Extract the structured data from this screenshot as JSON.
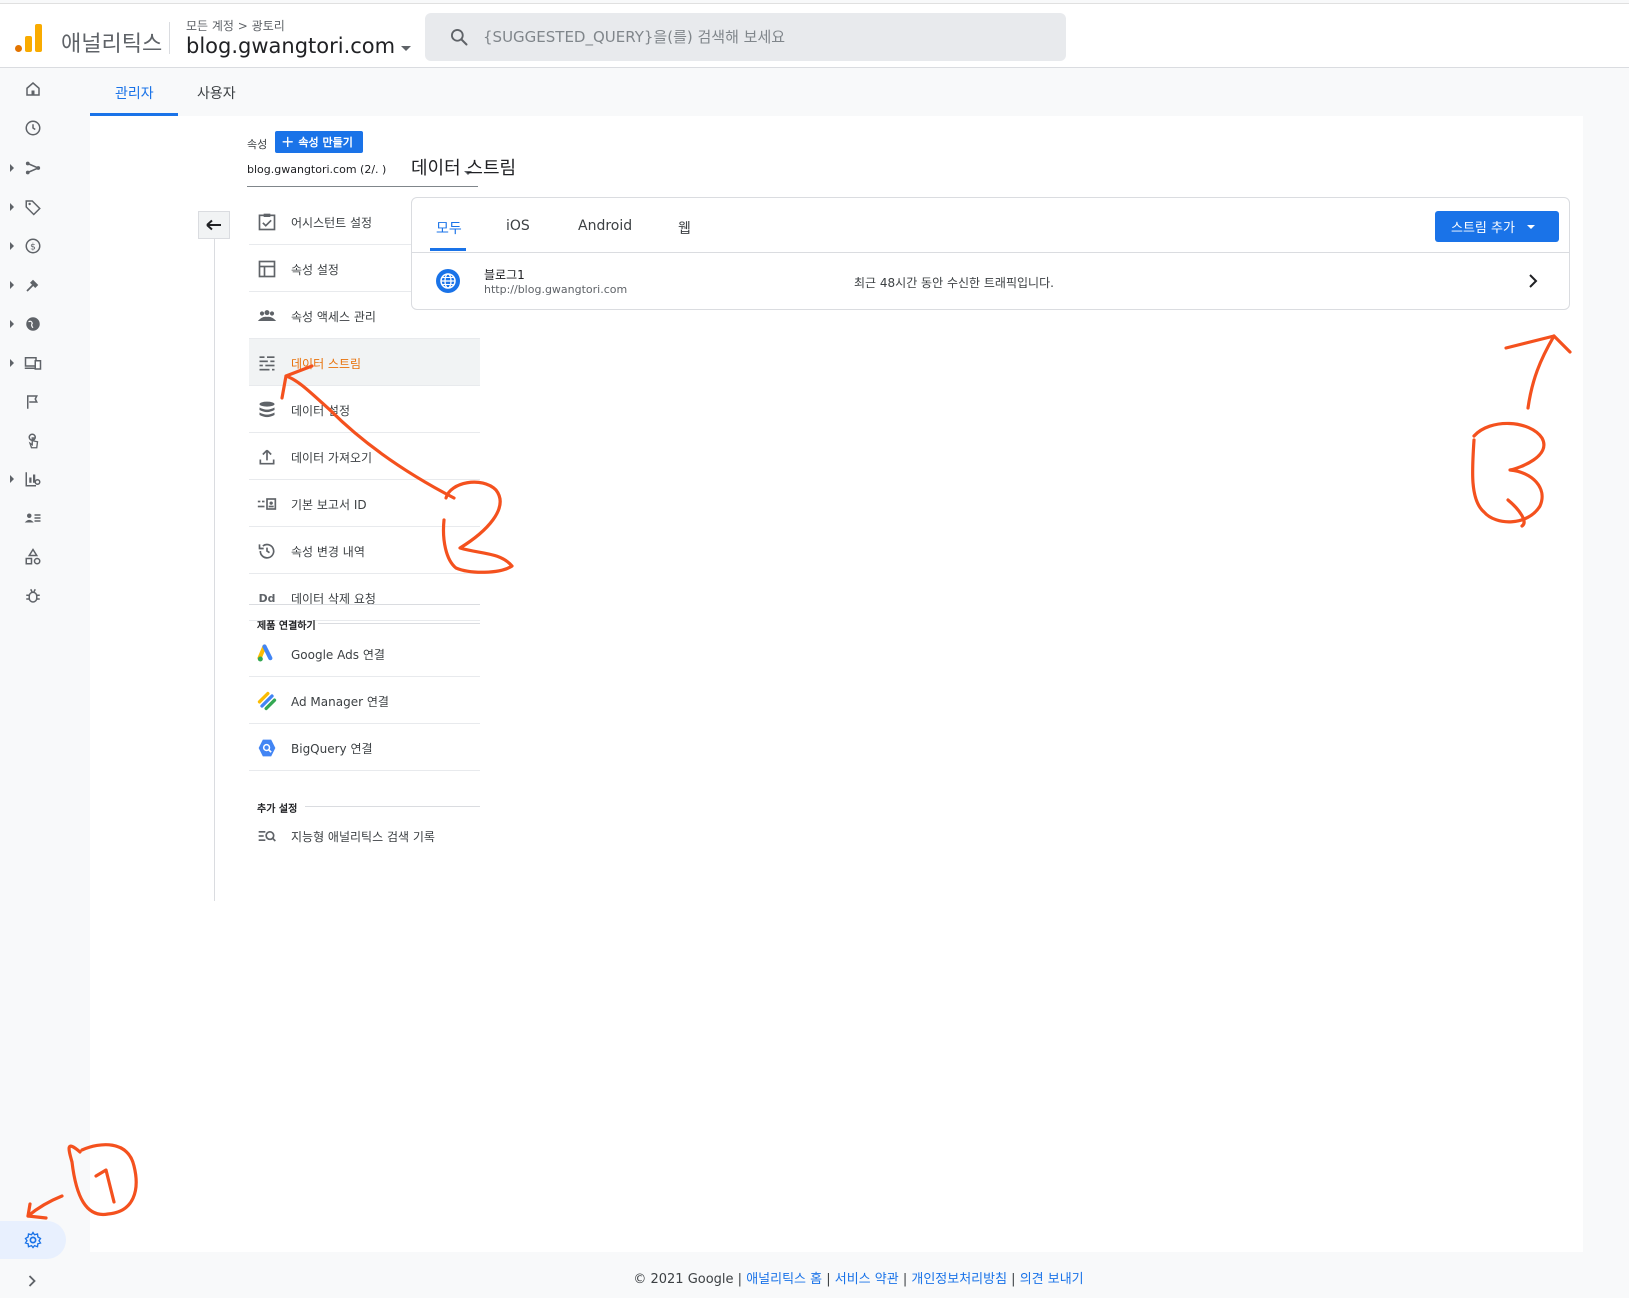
{
  "header": {
    "brand": "애널리틱스",
    "breadcrumb": "모든 계정 > 광토리",
    "account": "blog.gwangtori.com",
    "search_placeholder": "{SUGGESTED_QUERY}을(를) 검색해 보세요"
  },
  "admin_tabs": [
    {
      "label": "관리자",
      "active": true
    },
    {
      "label": "사용자",
      "active": false
    }
  ],
  "property": {
    "label": "속성",
    "create_label": "속성 만들기",
    "selected": "blog.gwangtori.com (2/.          )"
  },
  "menu": [
    {
      "label": "어시스턴트 설정",
      "icon": "checklist-icon"
    },
    {
      "label": "속성 설정",
      "icon": "layout-icon"
    },
    {
      "label": "속성 액세스 관리",
      "icon": "people-icon"
    },
    {
      "label": "데이터 스트림",
      "icon": "streams-icon",
      "active": true
    },
    {
      "label": "데이터 설정",
      "icon": "database-icon"
    },
    {
      "label": "데이터 가져오기",
      "icon": "upload-icon"
    },
    {
      "label": "기본 보고서 ID",
      "icon": "report-id-icon"
    },
    {
      "label": "속성 변경 내역",
      "icon": "history-icon"
    },
    {
      "label": "데이터 삭제 요청",
      "icon": "dd-icon"
    }
  ],
  "product_links": {
    "heading": "제품 연결하기",
    "items": [
      {
        "label": "Google Ads 연결",
        "icon": "google-ads-icon"
      },
      {
        "label": "Ad Manager 연결",
        "icon": "ad-manager-icon"
      },
      {
        "label": "BigQuery 연결",
        "icon": "bigquery-icon"
      }
    ]
  },
  "extra_settings": {
    "heading": "추가 설정",
    "items": [
      {
        "label": "지능형 애널리틱스 검색 기록",
        "icon": "search-history-icon"
      }
    ]
  },
  "content": {
    "title": "데이터 스트림",
    "tabs": [
      {
        "label": "모두",
        "active": true
      },
      {
        "label": "iOS",
        "active": false
      },
      {
        "label": "Android",
        "active": false
      },
      {
        "label": "웹",
        "active": false
      }
    ],
    "add_stream_label": "스트림 추가",
    "streams": [
      {
        "name": "블로그1",
        "url": "http://blog.gwangtori.com",
        "status": "최근 48시간 동안 수신한 트래픽입니다.",
        "icon": "globe-icon"
      }
    ]
  },
  "footer": {
    "copyright": "© 2021 Google",
    "links": [
      "애널리틱스 홈",
      "서비스 약관",
      "개인정보처리방침",
      "의견 보내기"
    ]
  },
  "annotations": {
    "marks": [
      "1",
      "2",
      "3"
    ],
    "color": "#f4511e"
  },
  "colors": {
    "accent": "#1a73e8",
    "active_menu": "#e8710a",
    "annotation": "#f4511e"
  }
}
